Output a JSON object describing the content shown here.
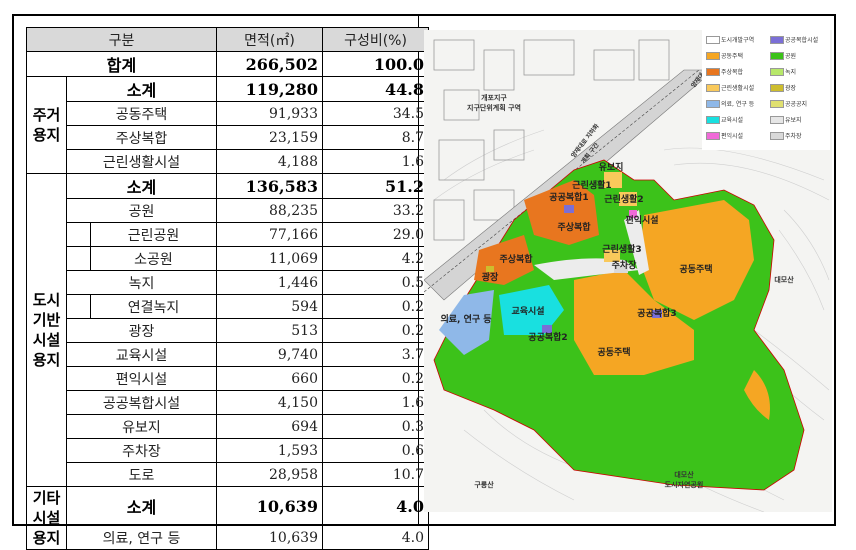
{
  "table": {
    "headers": {
      "category": "구분",
      "area": "면적(㎡)",
      "ratio": "구성비(%)"
    },
    "total": {
      "label": "합계",
      "area": "266,502",
      "ratio": "100.0"
    },
    "groups": [
      {
        "name": "주거용지",
        "name_lines": [
          "주거",
          "용지"
        ],
        "rows": [
          {
            "label": "소계",
            "area": "119,280",
            "ratio": "44.8",
            "bold": true
          },
          {
            "label": "공동주택",
            "area": "91,933",
            "ratio": "34.5"
          },
          {
            "label": "주상복합",
            "area": "23,159",
            "ratio": "8.7"
          },
          {
            "label": "근린생활시설",
            "area": "4,188",
            "ratio": "1.6"
          }
        ]
      },
      {
        "name": "도시기반시설용지",
        "name_lines": [
          "도시",
          "기반",
          "시설",
          "용지"
        ],
        "rows": [
          {
            "label": "소계",
            "area": "136,583",
            "ratio": "51.2",
            "bold": true
          },
          {
            "label": "공원",
            "area": "88,235",
            "ratio": "33.2"
          },
          {
            "label": "근린공원",
            "area": "77,166",
            "ratio": "29.0",
            "sub": true
          },
          {
            "label": "소공원",
            "area": "11,069",
            "ratio": "4.2",
            "sub": true
          },
          {
            "label": "녹지",
            "area": "1,446",
            "ratio": "0.5"
          },
          {
            "label": "연결녹지",
            "area": "594",
            "ratio": "0.2",
            "sub": true
          },
          {
            "label": "광장",
            "area": "513",
            "ratio": "0.2"
          },
          {
            "label": "교육시설",
            "area": "9,740",
            "ratio": "3.7"
          },
          {
            "label": "편익시설",
            "area": "660",
            "ratio": "0.2"
          },
          {
            "label": "공공복합시설",
            "area": "4,150",
            "ratio": "1.6"
          },
          {
            "label": "유보지",
            "area": "694",
            "ratio": "0.3"
          },
          {
            "label": "주차장",
            "area": "1,593",
            "ratio": "0.6"
          },
          {
            "label": "도로",
            "area": "28,958",
            "ratio": "10.7"
          }
        ]
      },
      {
        "name": "기타시설용지",
        "name_lines": [
          "기타",
          "시설",
          "용지"
        ],
        "rows": [
          {
            "label": "소계",
            "area": "10,639",
            "ratio": "4.0",
            "bold": true
          },
          {
            "label": "의료, 연구 등",
            "area": "10,639",
            "ratio": "4.0"
          }
        ]
      }
    ]
  },
  "map": {
    "legend": [
      {
        "label": "도시개발구역",
        "color": "#ffffff"
      },
      {
        "label": "공공복합시설",
        "color": "#7b6fd6"
      },
      {
        "label": "공동주택",
        "color": "#f5a623"
      },
      {
        "label": "공원",
        "color": "#3cc21a"
      },
      {
        "label": "주상복합",
        "color": "#e8761f"
      },
      {
        "label": "녹지",
        "color": "#b7e86a"
      },
      {
        "label": "근린생활시설",
        "color": "#f9c95b"
      },
      {
        "label": "광장",
        "color": "#cdbd2e"
      },
      {
        "label": "의료, 연구 등",
        "color": "#8fb8e8"
      },
      {
        "label": "공공공지",
        "color": "#e0e070"
      },
      {
        "label": "교육시설",
        "color": "#19e0e0"
      },
      {
        "label": "유보지",
        "color": "#e6e6e6"
      },
      {
        "label": "편익시설",
        "color": "#f06ad8"
      },
      {
        "label": "주차장",
        "color": "#d9d9d9"
      }
    ],
    "labels": {
      "yuboji": "유보지",
      "geunrin1": "근린생활1",
      "geunrin2": "근린생활2",
      "gonggong1": "공공복합1",
      "jusang_a": "주상복합",
      "pyeonik": "편익시설",
      "geunrin3": "근린생활3",
      "jucha": "주차장",
      "jusang_b": "주상복합",
      "gwangjang": "광장",
      "gongdong_e": "공동주택",
      "uiryo": "의료, 연구 등",
      "gyoyuk": "교육시설",
      "gonggong3": "공공복합3",
      "gonggong2": "공공복합2",
      "gongdong_c": "공동주택",
      "daemosan": "대모산",
      "gyepo1": "개포지구",
      "gyepo2": "지구단위계획 구역",
      "gureongsan": "구룡산",
      "dosi_park1": "대모산",
      "dosi_park2": "도시자연공원",
      "road": "양재대",
      "rail1": "양재대로 지하화",
      "rail2": "계획 구간"
    }
  }
}
